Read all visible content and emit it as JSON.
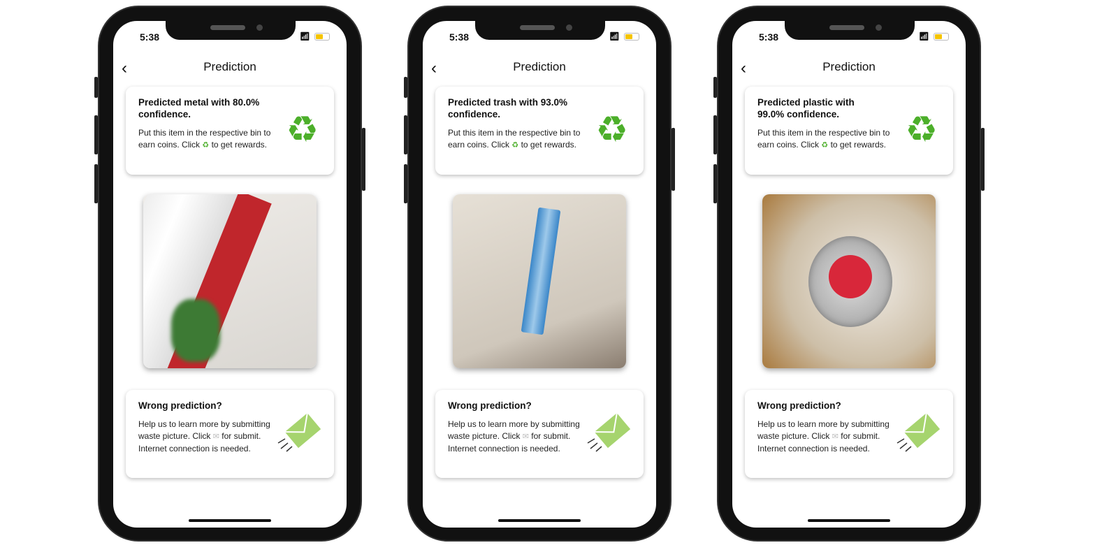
{
  "phones": [
    {
      "time": "5:38",
      "title": "Prediction",
      "prediction": "Predicted metal with 80.0% confidence.",
      "confidence": 80.0,
      "label": "metal",
      "instruction_pre": "Put this item in the respective bin to earn coins. Click",
      "instruction_post": "to get rewards.",
      "wrong_title": "Wrong prediction?",
      "wrong_pre": "Help us to learn more by submitting waste picture. Click",
      "wrong_post": "for submit. Internet connection is needed.",
      "photo_colors": [
        "#e9e6e2",
        "#c0262c",
        "#f2f2f2"
      ]
    },
    {
      "time": "5:38",
      "title": "Prediction",
      "prediction": "Predicted trash with 93.0% confidence.",
      "confidence": 93.0,
      "label": "trash",
      "instruction_pre": "Put this item in the respective bin to earn coins. Click",
      "instruction_post": "to get rewards.",
      "wrong_title": "Wrong prediction?",
      "wrong_pre": "Help us to learn more by submitting waste picture. Click",
      "wrong_post": "for submit. Internet connection is needed.",
      "photo_colors": [
        "#ddd6cc",
        "#3a86c8",
        "#c9bfb2"
      ]
    },
    {
      "time": "5:38",
      "title": "Prediction",
      "prediction": "Predicted plastic with 99.0% confidence.",
      "confidence": 99.0,
      "label": "plastic",
      "instruction_pre": "Put this item in the respective bin to earn coins. Click",
      "instruction_post": "to get rewards.",
      "wrong_title": "Wrong prediction?",
      "wrong_pre": "Help us to learn more by submitting waste picture. Click",
      "wrong_post": "for submit. Internet connection is needed.",
      "photo_colors": [
        "#d9cdb8",
        "#d8273a",
        "#b98a4a"
      ]
    }
  ],
  "icons": {
    "back": "chevron-left-icon",
    "recycle": "recycle-icon",
    "mail": "envelope-icon",
    "wifi": "wifi-icon",
    "battery": "battery-icon"
  },
  "colors": {
    "recycle": "#4caf2a",
    "envelope": "#a6d46e",
    "battery": "#f5c400"
  }
}
